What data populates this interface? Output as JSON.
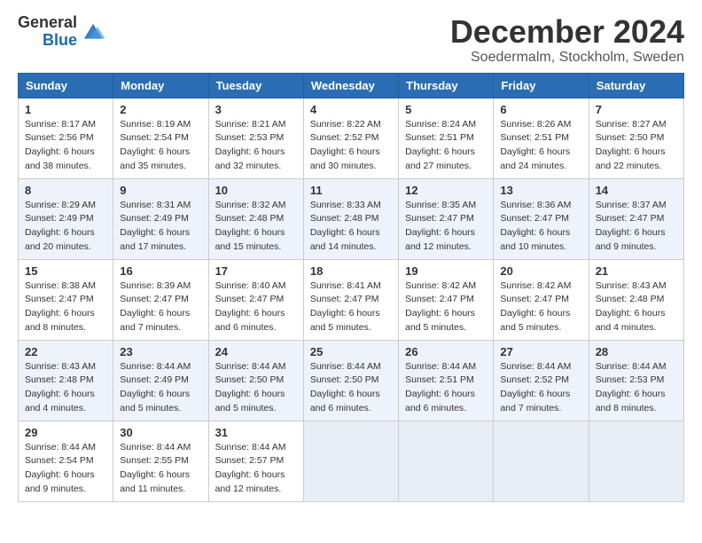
{
  "header": {
    "logo_general": "General",
    "logo_blue": "Blue",
    "title": "December 2024",
    "subtitle": "Soedermalm, Stockholm, Sweden"
  },
  "days_of_week": [
    "Sunday",
    "Monday",
    "Tuesday",
    "Wednesday",
    "Thursday",
    "Friday",
    "Saturday"
  ],
  "weeks": [
    [
      {
        "day": "1",
        "sunrise": "8:17 AM",
        "sunset": "2:56 PM",
        "daylight": "6 hours and 38 minutes."
      },
      {
        "day": "2",
        "sunrise": "8:19 AM",
        "sunset": "2:54 PM",
        "daylight": "6 hours and 35 minutes."
      },
      {
        "day": "3",
        "sunrise": "8:21 AM",
        "sunset": "2:53 PM",
        "daylight": "6 hours and 32 minutes."
      },
      {
        "day": "4",
        "sunrise": "8:22 AM",
        "sunset": "2:52 PM",
        "daylight": "6 hours and 30 minutes."
      },
      {
        "day": "5",
        "sunrise": "8:24 AM",
        "sunset": "2:51 PM",
        "daylight": "6 hours and 27 minutes."
      },
      {
        "day": "6",
        "sunrise": "8:26 AM",
        "sunset": "2:51 PM",
        "daylight": "6 hours and 24 minutes."
      },
      {
        "day": "7",
        "sunrise": "8:27 AM",
        "sunset": "2:50 PM",
        "daylight": "6 hours and 22 minutes."
      }
    ],
    [
      {
        "day": "8",
        "sunrise": "8:29 AM",
        "sunset": "2:49 PM",
        "daylight": "6 hours and 20 minutes."
      },
      {
        "day": "9",
        "sunrise": "8:31 AM",
        "sunset": "2:49 PM",
        "daylight": "6 hours and 17 minutes."
      },
      {
        "day": "10",
        "sunrise": "8:32 AM",
        "sunset": "2:48 PM",
        "daylight": "6 hours and 15 minutes."
      },
      {
        "day": "11",
        "sunrise": "8:33 AM",
        "sunset": "2:48 PM",
        "daylight": "6 hours and 14 minutes."
      },
      {
        "day": "12",
        "sunrise": "8:35 AM",
        "sunset": "2:47 PM",
        "daylight": "6 hours and 12 minutes."
      },
      {
        "day": "13",
        "sunrise": "8:36 AM",
        "sunset": "2:47 PM",
        "daylight": "6 hours and 10 minutes."
      },
      {
        "day": "14",
        "sunrise": "8:37 AM",
        "sunset": "2:47 PM",
        "daylight": "6 hours and 9 minutes."
      }
    ],
    [
      {
        "day": "15",
        "sunrise": "8:38 AM",
        "sunset": "2:47 PM",
        "daylight": "6 hours and 8 minutes."
      },
      {
        "day": "16",
        "sunrise": "8:39 AM",
        "sunset": "2:47 PM",
        "daylight": "6 hours and 7 minutes."
      },
      {
        "day": "17",
        "sunrise": "8:40 AM",
        "sunset": "2:47 PM",
        "daylight": "6 hours and 6 minutes."
      },
      {
        "day": "18",
        "sunrise": "8:41 AM",
        "sunset": "2:47 PM",
        "daylight": "6 hours and 5 minutes."
      },
      {
        "day": "19",
        "sunrise": "8:42 AM",
        "sunset": "2:47 PM",
        "daylight": "6 hours and 5 minutes."
      },
      {
        "day": "20",
        "sunrise": "8:42 AM",
        "sunset": "2:47 PM",
        "daylight": "6 hours and 5 minutes."
      },
      {
        "day": "21",
        "sunrise": "8:43 AM",
        "sunset": "2:48 PM",
        "daylight": "6 hours and 4 minutes."
      }
    ],
    [
      {
        "day": "22",
        "sunrise": "8:43 AM",
        "sunset": "2:48 PM",
        "daylight": "6 hours and 4 minutes."
      },
      {
        "day": "23",
        "sunrise": "8:44 AM",
        "sunset": "2:49 PM",
        "daylight": "6 hours and 5 minutes."
      },
      {
        "day": "24",
        "sunrise": "8:44 AM",
        "sunset": "2:50 PM",
        "daylight": "6 hours and 5 minutes."
      },
      {
        "day": "25",
        "sunrise": "8:44 AM",
        "sunset": "2:50 PM",
        "daylight": "6 hours and 6 minutes."
      },
      {
        "day": "26",
        "sunrise": "8:44 AM",
        "sunset": "2:51 PM",
        "daylight": "6 hours and 6 minutes."
      },
      {
        "day": "27",
        "sunrise": "8:44 AM",
        "sunset": "2:52 PM",
        "daylight": "6 hours and 7 minutes."
      },
      {
        "day": "28",
        "sunrise": "8:44 AM",
        "sunset": "2:53 PM",
        "daylight": "6 hours and 8 minutes."
      }
    ],
    [
      {
        "day": "29",
        "sunrise": "8:44 AM",
        "sunset": "2:54 PM",
        "daylight": "6 hours and 9 minutes."
      },
      {
        "day": "30",
        "sunrise": "8:44 AM",
        "sunset": "2:55 PM",
        "daylight": "6 hours and 11 minutes."
      },
      {
        "day": "31",
        "sunrise": "8:44 AM",
        "sunset": "2:57 PM",
        "daylight": "6 hours and 12 minutes."
      },
      null,
      null,
      null,
      null
    ]
  ],
  "labels": {
    "sunrise": "Sunrise:",
    "sunset": "Sunset:",
    "daylight": "Daylight:"
  }
}
